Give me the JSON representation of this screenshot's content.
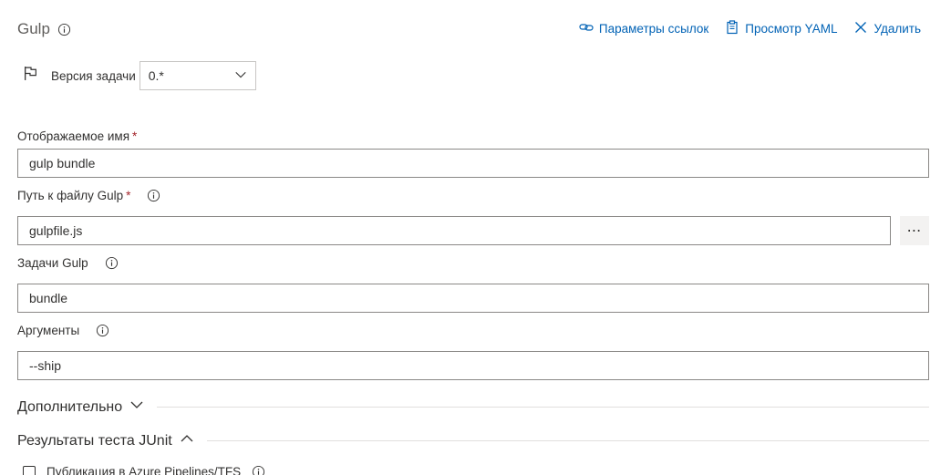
{
  "header": {
    "title": "Gulp",
    "actions": [
      {
        "label": "Параметры ссылок",
        "icon": "link-icon"
      },
      {
        "label": "Просмотр YAML",
        "icon": "clipboard-icon"
      },
      {
        "label": "Удалить",
        "icon": "close-icon"
      }
    ]
  },
  "version": {
    "label": "Версия задачи",
    "value": "0.*"
  },
  "fields": {
    "display_name": {
      "label": "Отображаемое имя",
      "required": "*",
      "value": "gulp bundle"
    },
    "gulp_file": {
      "label": "Путь к файлу Gulp",
      "required": "*",
      "value": "gulpfile.js",
      "more": "⋯"
    },
    "gulp_tasks": {
      "label": "Задачи Gulp",
      "value": "bundle"
    },
    "arguments": {
      "label": "Аргументы",
      "value": "--ship"
    }
  },
  "sections": {
    "advanced": "Дополнительно",
    "junit": "Результаты теста JUnit"
  },
  "publish": {
    "label": "Публикация в Azure Pipelines/TFS"
  },
  "colors": {
    "accent": "#0062b5",
    "required": "#a4262c",
    "border": "#8a8886"
  }
}
